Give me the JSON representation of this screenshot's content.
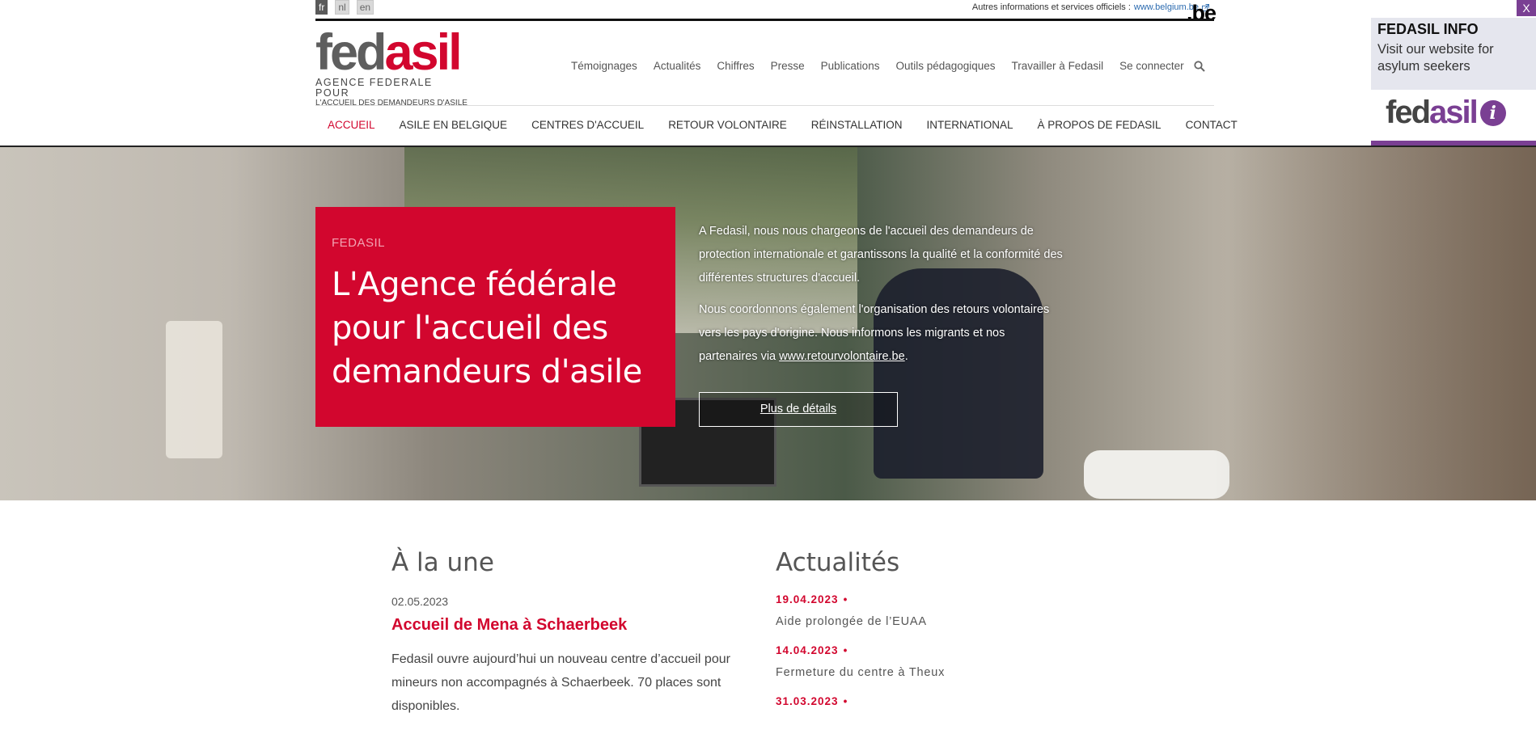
{
  "languages": [
    "fr",
    "nl",
    "en"
  ],
  "gov": {
    "label": "Autres informations et services officiels :",
    "link": "www.belgium.be",
    "logo": ".be"
  },
  "logo": {
    "word_fed": "fed",
    "word_asil": "asil",
    "sub1": "AGENCE FEDERALE POUR",
    "sub2": "L'ACCUEIL DES DEMANDEURS D'ASILE"
  },
  "topnav": [
    "Témoignages",
    "Actualités",
    "Chiffres",
    "Presse",
    "Publications",
    "Outils pédagogiques",
    "Travailler à Fedasil",
    "Se connecter"
  ],
  "mainnav": [
    "ACCUEIL",
    "ASILE EN BELGIQUE",
    "CENTRES D'ACCUEIL",
    "RETOUR VOLONTAIRE",
    "RÉINSTALLATION",
    "INTERNATIONAL",
    "À PROPOS DE FEDASIL",
    "CONTACT"
  ],
  "hero": {
    "kicker": "FEDASIL",
    "title": "L'Agence fédérale pour l'accueil des demandeurs d'asile",
    "p1": "A Fedasil, nous nous chargeons de l'accueil des demandeurs de protection internationale et garantissons la qualité et la conformité des différentes structures d'accueil.",
    "p2_start": "Nous coordonnons également l'organisation des retours volontaires vers les pays d'origine. Nous informons les migrants et nos partenaires via ",
    "p2_link": "www.retourvolontaire.be",
    "p2_end": ".",
    "button": "Plus de détails"
  },
  "une": {
    "title": "À la une",
    "date": "02.05.2023",
    "headline": "Accueil de Mena à Schaerbeek",
    "body": "Fedasil ouvre aujourd’hui un nouveau centre d’accueil pour mineurs non accompagnés à Schaerbeek. 70 places sont disponibles."
  },
  "actualites": {
    "title": "Actualités",
    "items": [
      {
        "date": "19.04.2023",
        "title": "Aide prolongée de l’EUAA"
      },
      {
        "date": "14.04.2023",
        "title": "Fermeture du centre à Theux"
      },
      {
        "date": "31.03.2023",
        "title": ""
      }
    ]
  },
  "widget": {
    "title": "FEDASIL INFO",
    "text": "Visit our website for asylum seekers",
    "logo_fed": "fed",
    "logo_asil": "asil",
    "info": "i",
    "close": "X"
  },
  "colors": {
    "brand_red": "#d2062e",
    "widget_purple": "#7a3f93"
  }
}
